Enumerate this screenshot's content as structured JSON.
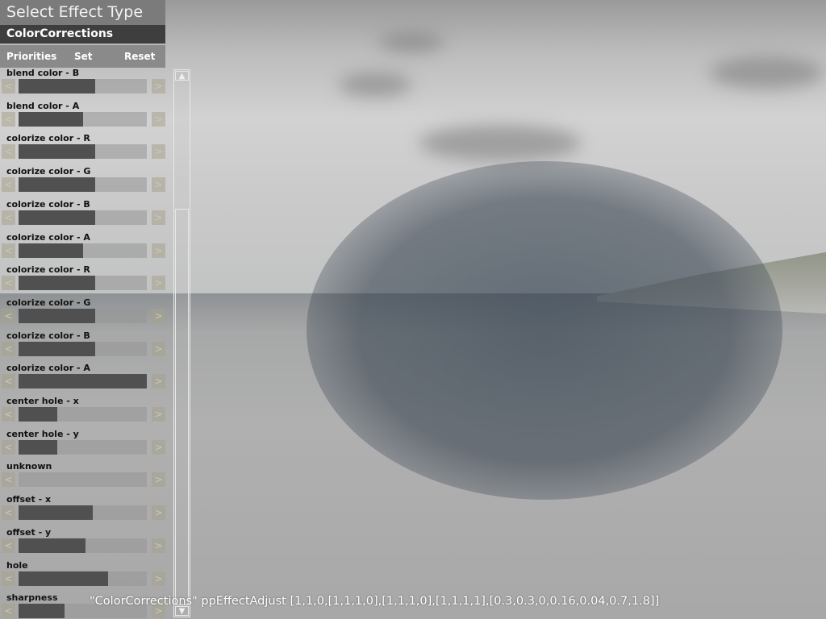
{
  "panel": {
    "title": "Select Effect Type",
    "effect_type": "ColorCorrections",
    "buttons": {
      "priorities": "Priorities",
      "set": "Set",
      "reset": "Reset"
    },
    "arrows": {
      "left": "<",
      "right": ">"
    },
    "params": [
      {
        "label": "blend color - B",
        "value": 0.6
      },
      {
        "label": "blend color - A",
        "value": 0.5
      },
      {
        "label": "colorize color - R",
        "value": 0.6
      },
      {
        "label": "colorize color - G",
        "value": 0.6
      },
      {
        "label": "colorize color - B",
        "value": 0.6
      },
      {
        "label": "colorize color - A",
        "value": 0.5
      },
      {
        "label": "colorize color - R",
        "value": 0.6
      },
      {
        "label": "colorize color - G",
        "value": 0.6
      },
      {
        "label": "colorize color - B",
        "value": 0.6
      },
      {
        "label": "colorize color - A",
        "value": 1.0
      },
      {
        "label": "center hole - x",
        "value": 0.3
      },
      {
        "label": "center hole - y",
        "value": 0.3
      },
      {
        "label": "unknown",
        "value": 0.0
      },
      {
        "label": "offset - x",
        "value": 0.58
      },
      {
        "label": "offset - y",
        "value": 0.52
      },
      {
        "label": "hole",
        "value": 0.7
      },
      {
        "label": "sharpness",
        "value": 0.36
      }
    ]
  },
  "scrollbar": {
    "up_icon": "▲",
    "down_icon": "▼"
  },
  "status_line": "\"ColorCorrections\" ppEffectAdjust [1,1,0,[1,1,1,0],[1,1,1,0],[1,1,1,1],[0.3,0.3,0,0.16,0.04,0.7,1.8]]"
}
